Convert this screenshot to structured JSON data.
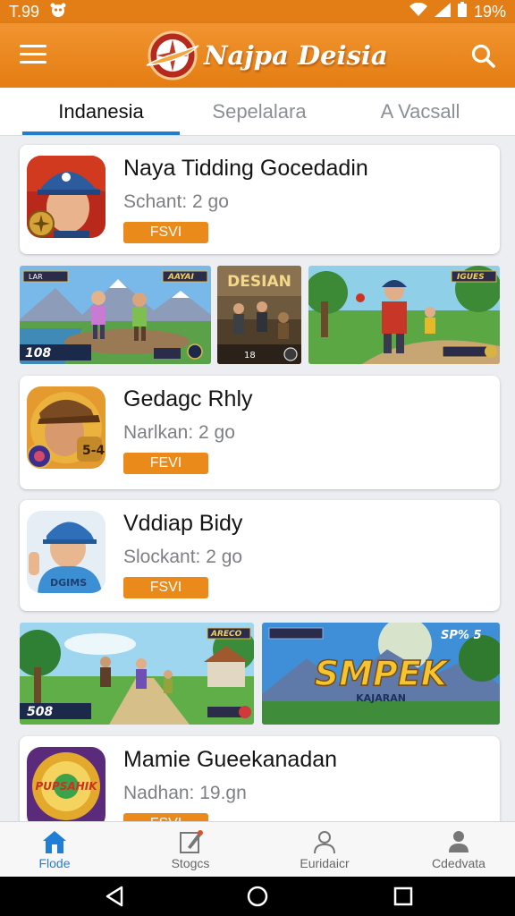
{
  "status": {
    "time": "T.99",
    "battery": "19%"
  },
  "header": {
    "title": "Najpa Deisia"
  },
  "tabs": [
    {
      "label": "Indanesia",
      "active": true
    },
    {
      "label": "Sepelalara",
      "active": false
    },
    {
      "label": "A Vacsall",
      "active": false
    }
  ],
  "apps": [
    {
      "name": "Naya Tidding Gocedadin",
      "meta": "Schant: 2 go",
      "badge": "FSVI"
    },
    {
      "name": "Gedagc Rhly",
      "meta": "Narlkan: 2 go",
      "badge": "FEVI"
    },
    {
      "name": "Vddiap Bidy",
      "meta": "Slockant: 2 go",
      "badge": "FSVI"
    },
    {
      "name": "Mamie Gueekanadan",
      "meta": "Nadhan: 19.gn",
      "badge": "FSVI"
    }
  ],
  "banners": {
    "b1": {
      "hud_left": "LAR",
      "hud_right": "AAYAI",
      "score": "108"
    },
    "b2": {
      "title": "DESIAN",
      "score": "18"
    },
    "b3": {
      "hud_right": "IGUES"
    },
    "b4": {
      "hud_right": "ARECO",
      "score": "508"
    },
    "b5": {
      "hud_right": "SP% 5",
      "title": "SMPEK",
      "subtitle": "KAJARAN"
    }
  },
  "icon_texts": {
    "app2": "5-4",
    "app3": "DGIMS",
    "app4": "PUPSAHIK"
  },
  "bottom_nav": [
    {
      "label": "Flode",
      "icon": "home-icon",
      "active": true
    },
    {
      "label": "Stogcs",
      "icon": "edit-icon",
      "active": false
    },
    {
      "label": "Euridaicr",
      "icon": "person-outline-icon",
      "active": false
    },
    {
      "label": "Cdedvata",
      "icon": "person-filled-icon",
      "active": false
    }
  ],
  "colors": {
    "accent": "#e37e16",
    "tab_indicator": "#1e7fd0",
    "badge": "#ea8a1a",
    "nav_active": "#1f7ed6"
  }
}
